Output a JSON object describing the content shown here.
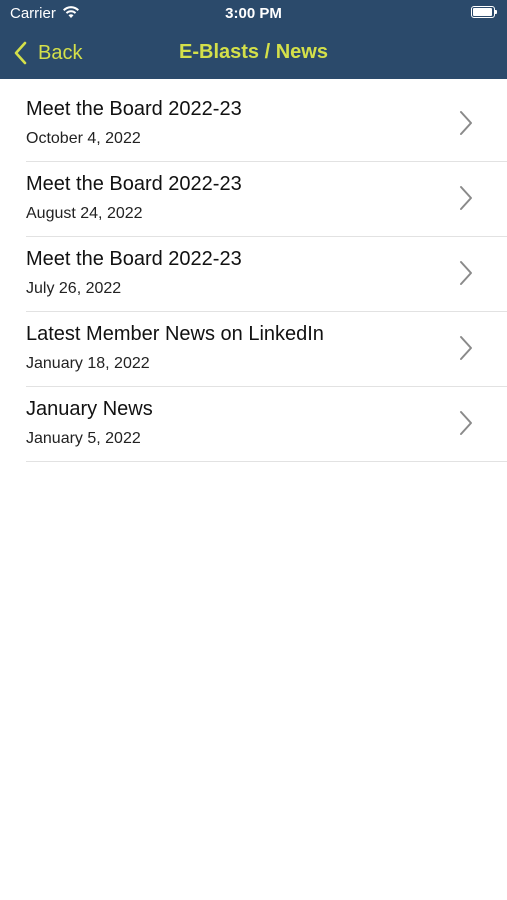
{
  "status_bar": {
    "carrier": "Carrier",
    "time": "3:00 PM",
    "wifi_icon": "wifi-icon",
    "battery_icon": "battery-icon"
  },
  "nav": {
    "back_label": "Back",
    "title": "E-Blasts / News",
    "accent_color": "#d4e04a",
    "bar_color": "#2b4a6b"
  },
  "items": [
    {
      "title": "Meet the Board 2022-23",
      "date": "October 4, 2022"
    },
    {
      "title": "Meet the Board 2022-23",
      "date": "August 24, 2022"
    },
    {
      "title": "Meet the Board 2022-23",
      "date": "July 26, 2022"
    },
    {
      "title": "Latest Member News on LinkedIn",
      "date": "January 18, 2022"
    },
    {
      "title": "January News",
      "date": "January 5, 2022"
    }
  ]
}
